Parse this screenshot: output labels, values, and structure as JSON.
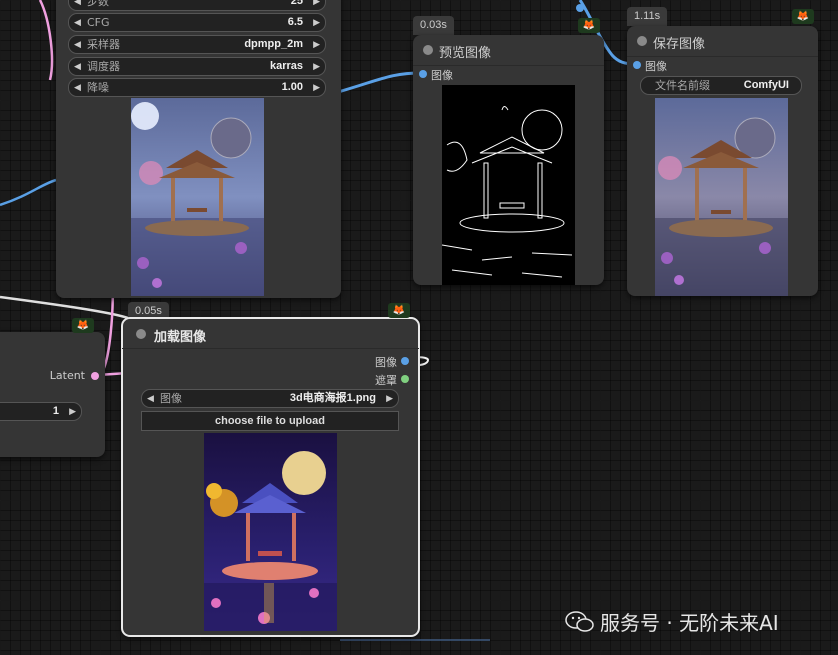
{
  "nodes": {
    "sampler": {
      "widgets": [
        {
          "label": "步数",
          "value": "25"
        },
        {
          "label": "CFG",
          "value": "6.5"
        },
        {
          "label": "采样器",
          "value": "dpmpp_2m"
        },
        {
          "label": "调度器",
          "value": "karras"
        },
        {
          "label": "降噪",
          "value": "1.00"
        }
      ]
    },
    "preview": {
      "time": "0.03s",
      "title": "预览图像",
      "input": "图像"
    },
    "save": {
      "time": "1.11s",
      "title": "保存图像",
      "input": "图像",
      "prefix_label": "文件名前缀",
      "prefix_value": "ComfyUI"
    },
    "load": {
      "time": "0.05s",
      "title": "加载图像",
      "outputs": [
        "图像",
        "遮罩"
      ],
      "image_label": "图像",
      "image_value": "3d电商海报1.png",
      "upload_label": "choose file to upload"
    },
    "left": {
      "output": "Latent",
      "value": "1"
    }
  },
  "watermark": "服务号 · 无阶未来AI",
  "colors": {
    "image_wire": "#5aa0e6",
    "latent_wire": "#f0a0e0",
    "node_bg": "#353535"
  }
}
